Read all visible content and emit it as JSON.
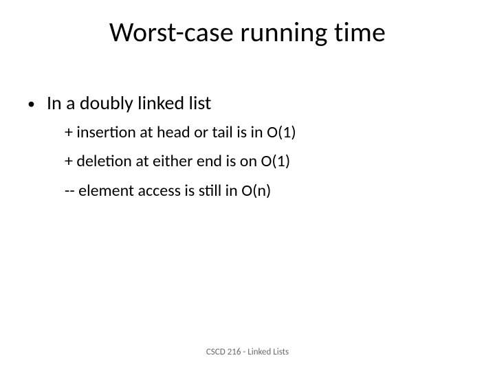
{
  "title": "Worst-case running time",
  "bullet": {
    "marker": "•",
    "text": "In a doubly linked list",
    "sub": [
      "+ insertion at head or tail is in O(1)",
      "+ deletion at either end is on O(1)",
      "-- element access is still in O(n)"
    ]
  },
  "footer": "CSCD 216 - Linked Lists"
}
